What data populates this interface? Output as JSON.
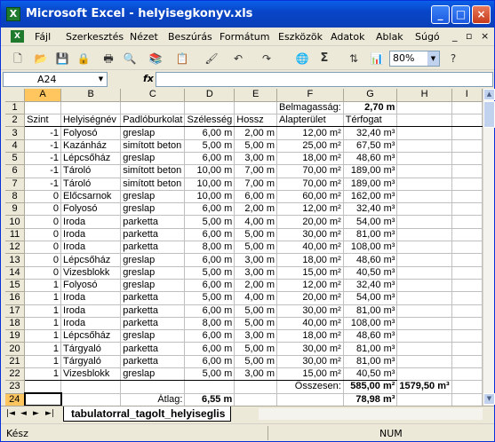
{
  "window": {
    "title": "Microsoft Excel - helyisegkonyv.xls",
    "app_icon": "X",
    "buttons": {
      "minimize": "_",
      "maximize": "□",
      "close": "×"
    }
  },
  "menu": [
    "Fájl",
    "Szerkesztés",
    "Nézet",
    "Beszúrás",
    "Formátum",
    "Eszközök",
    "Adatok",
    "Ablak",
    "Súgó"
  ],
  "menu_doc_controls": {
    "minimize": "_",
    "restore": "▫",
    "close": "×"
  },
  "toolbar": {
    "zoom": "80%",
    "sum_label": "Σ",
    "icons": [
      "new-icon",
      "open-icon",
      "save-icon",
      "permission-icon",
      "print-icon",
      "print-preview-icon",
      "research-icon",
      "paste-icon",
      "format-painter-icon",
      "undo-icon",
      "redo-icon",
      "hyperlink-icon",
      "autosum-icon",
      "sort-icon",
      "chart-icon",
      "help-icon"
    ]
  },
  "formula_bar": {
    "cell_ref": "A24",
    "fx_label": "fx",
    "content": ""
  },
  "columns": [
    "A",
    "B",
    "C",
    "D",
    "E",
    "F",
    "G",
    "H",
    "I"
  ],
  "rows": [
    {
      "n": "1",
      "cells": [
        "",
        "",
        "",
        "",
        "",
        "Belmagasság:",
        "2,70 m",
        "",
        ""
      ]
    },
    {
      "n": "2",
      "cells": [
        "Szint",
        "Helyiségnév",
        "Padlóburkolat",
        "Szélesség",
        "Hossz",
        "Alapterület",
        "Térfogat",
        "",
        ""
      ]
    },
    {
      "n": "3",
      "cells": [
        "-1",
        "Folyosó",
        "greslap",
        "6,00 m",
        "2,00 m",
        "12,00 m²",
        "32,40 m³",
        "",
        ""
      ]
    },
    {
      "n": "4",
      "cells": [
        "-1",
        "Kazánház",
        "simított beton",
        "5,00 m",
        "5,00 m",
        "25,00 m²",
        "67,50 m³",
        "",
        ""
      ]
    },
    {
      "n": "5",
      "cells": [
        "-1",
        "Lépcsőház",
        "greslap",
        "6,00 m",
        "3,00 m",
        "18,00 m²",
        "48,60 m³",
        "",
        ""
      ]
    },
    {
      "n": "6",
      "cells": [
        "-1",
        "Tároló",
        "simított beton",
        "10,00 m",
        "7,00 m",
        "70,00 m²",
        "189,00 m³",
        "",
        ""
      ]
    },
    {
      "n": "7",
      "cells": [
        "-1",
        "Tároló",
        "simított beton",
        "10,00 m",
        "7,00 m",
        "70,00 m²",
        "189,00 m³",
        "",
        ""
      ]
    },
    {
      "n": "8",
      "cells": [
        "0",
        "Előcsarnok",
        "greslap",
        "10,00 m",
        "6,00 m",
        "60,00 m²",
        "162,00 m³",
        "",
        ""
      ]
    },
    {
      "n": "9",
      "cells": [
        "0",
        "Folyosó",
        "greslap",
        "6,00 m",
        "2,00 m",
        "12,00 m²",
        "32,40 m³",
        "",
        ""
      ]
    },
    {
      "n": "10",
      "cells": [
        "0",
        "Iroda",
        "parketta",
        "5,00 m",
        "4,00 m",
        "20,00 m²",
        "54,00 m³",
        "",
        ""
      ]
    },
    {
      "n": "11",
      "cells": [
        "0",
        "Iroda",
        "parketta",
        "6,00 m",
        "5,00 m",
        "30,00 m²",
        "81,00 m³",
        "",
        ""
      ]
    },
    {
      "n": "12",
      "cells": [
        "0",
        "Iroda",
        "parketta",
        "8,00 m",
        "5,00 m",
        "40,00 m²",
        "108,00 m³",
        "",
        ""
      ]
    },
    {
      "n": "13",
      "cells": [
        "0",
        "Lépcsőház",
        "greslap",
        "6,00 m",
        "3,00 m",
        "18,00 m²",
        "48,60 m³",
        "",
        ""
      ]
    },
    {
      "n": "14",
      "cells": [
        "0",
        "Vizesblokk",
        "greslap",
        "5,00 m",
        "3,00 m",
        "15,00 m²",
        "40,50 m³",
        "",
        ""
      ]
    },
    {
      "n": "15",
      "cells": [
        "1",
        "Folyosó",
        "greslap",
        "6,00 m",
        "2,00 m",
        "12,00 m²",
        "32,40 m³",
        "",
        ""
      ]
    },
    {
      "n": "16",
      "cells": [
        "1",
        "Iroda",
        "parketta",
        "5,00 m",
        "4,00 m",
        "20,00 m²",
        "54,00 m³",
        "",
        ""
      ]
    },
    {
      "n": "17",
      "cells": [
        "1",
        "Iroda",
        "parketta",
        "6,00 m",
        "5,00 m",
        "30,00 m²",
        "81,00 m³",
        "",
        ""
      ]
    },
    {
      "n": "18",
      "cells": [
        "1",
        "Iroda",
        "parketta",
        "8,00 m",
        "5,00 m",
        "40,00 m²",
        "108,00 m³",
        "",
        ""
      ]
    },
    {
      "n": "19",
      "cells": [
        "1",
        "Lépcsőház",
        "greslap",
        "6,00 m",
        "3,00 m",
        "18,00 m²",
        "48,60 m³",
        "",
        ""
      ]
    },
    {
      "n": "20",
      "cells": [
        "1",
        "Tárgyaló",
        "parketta",
        "6,00 m",
        "5,00 m",
        "30,00 m²",
        "81,00 m³",
        "",
        ""
      ]
    },
    {
      "n": "21",
      "cells": [
        "1",
        "Tárgyaló",
        "parketta",
        "6,00 m",
        "5,00 m",
        "30,00 m²",
        "81,00 m³",
        "",
        ""
      ]
    },
    {
      "n": "22",
      "cells": [
        "1",
        "Vizesblokk",
        "greslap",
        "5,00 m",
        "3,00 m",
        "15,00 m²",
        "40,50 m³",
        "",
        ""
      ]
    },
    {
      "n": "23",
      "cells": [
        "",
        "",
        "",
        "",
        "",
        "Összesen:",
        "585,00 m²",
        "1579,50 m³",
        ""
      ]
    },
    {
      "n": "24",
      "cells": [
        "",
        "",
        "Átlag:",
        "6,55 m",
        "",
        "",
        "78,98 m³",
        "",
        ""
      ]
    },
    {
      "n": "25",
      "cells": [
        "",
        "",
        "",
        "",
        "",
        "",
        "",
        "",
        ""
      ]
    }
  ],
  "sheet_tab": "tabulatorral_tagolt_helyiseglis",
  "tab_nav": [
    "|◄",
    "◄",
    "►",
    "►|"
  ],
  "status": {
    "ready": "Kész",
    "num": "NUM"
  }
}
